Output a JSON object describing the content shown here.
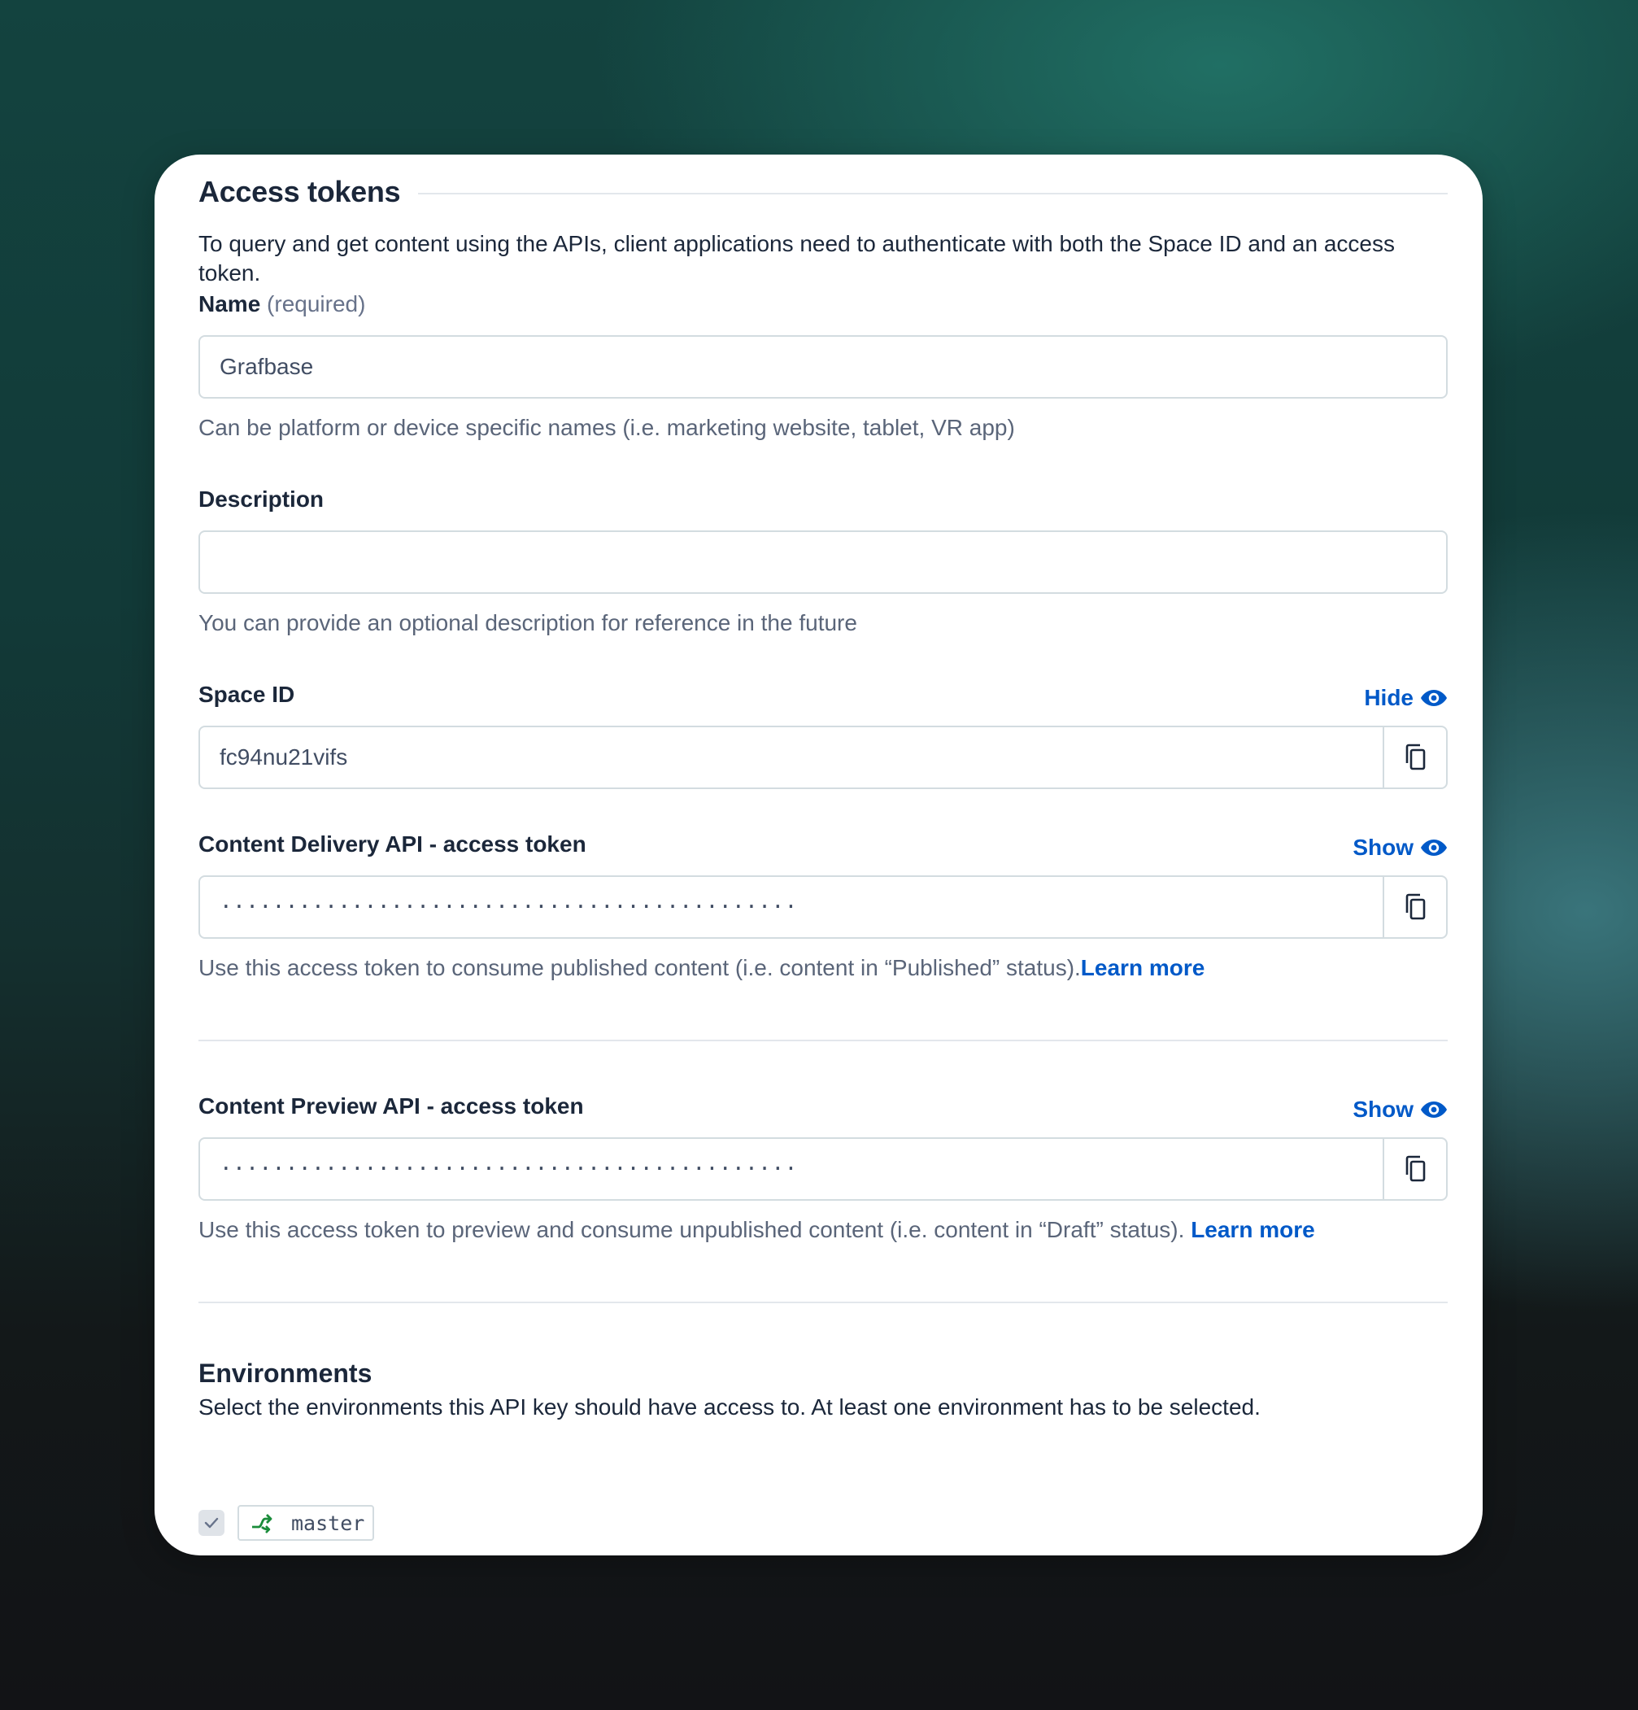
{
  "section": {
    "title": "Access tokens",
    "intro": "To query and get content using the APIs, client applications need to authenticate with both the Space ID and an access token."
  },
  "name_field": {
    "label": "Name",
    "required_hint": "(required)",
    "value": "Grafbase",
    "help": "Can be platform or device specific names (i.e. marketing website, tablet, VR app)"
  },
  "description_field": {
    "label": "Description",
    "value": "",
    "help": "You can provide an optional description for reference in the future"
  },
  "space_id": {
    "label": "Space ID",
    "toggle_label": "Hide",
    "value": "fc94nu21vifs"
  },
  "delivery_token": {
    "label": "Content Delivery API - access token",
    "toggle_label": "Show",
    "value": "············································",
    "help": "Use this access token to consume published content (i.e. content in “Published” status).",
    "link": "Learn more"
  },
  "preview_token": {
    "label": "Content Preview API - access token",
    "toggle_label": "Show",
    "value": "············································",
    "help": "Use this access token to preview and consume unpublished content (i.e. content in “Draft” status). ",
    "link": "Learn more"
  },
  "environments": {
    "title": "Environments",
    "description": "Select the environments this API key should have access to. At least one environment has to be selected.",
    "items": [
      {
        "name": "master",
        "checked": true,
        "icon": "branch-icon"
      }
    ]
  },
  "colors": {
    "accent": "#0059c8",
    "text": "#1b273a",
    "muted": "#5a6579",
    "border": "#d3dce0",
    "branch_green": "#1a8c3a"
  }
}
